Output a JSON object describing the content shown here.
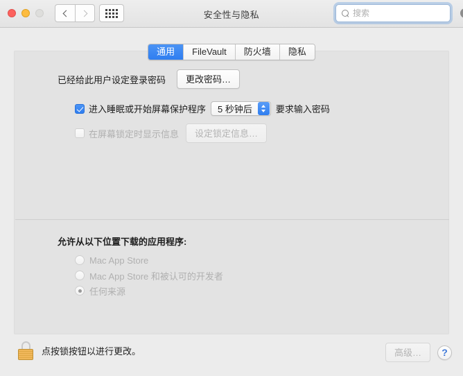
{
  "window": {
    "title": "安全性与隐私",
    "traffic_lights": [
      "close",
      "minimize",
      "zoom"
    ]
  },
  "toolbar": {
    "back_icon": "chevron-left-icon",
    "forward_icon": "chevron-right-icon",
    "show_all_icon": "grid-icon",
    "search": {
      "placeholder": "搜索",
      "value": "",
      "icon": "search-icon",
      "clear_icon": "clear-icon"
    }
  },
  "tabs": [
    {
      "label": "通用",
      "active": true
    },
    {
      "label": "FileVault",
      "active": false
    },
    {
      "label": "防火墙",
      "active": false
    },
    {
      "label": "隐私",
      "active": false
    }
  ],
  "general": {
    "password_status_label": "已经给此用户设定登录密码",
    "change_password_button": "更改密码…",
    "require_password": {
      "checked": true,
      "prefix_label": "进入睡眠或开始屏幕保护程序",
      "delay_value": "5 秒钟后",
      "suffix_label": "要求输入密码"
    },
    "lock_message": {
      "checked": false,
      "label": "在屏幕锁定时显示信息",
      "button": "设定锁定信息…",
      "disabled": true
    },
    "download_section_title": "允许从以下位置下载的应用程序:",
    "download_options": [
      {
        "label": "Mac App Store",
        "selected": false
      },
      {
        "label": "Mac App Store 和被认可的开发者",
        "selected": false
      },
      {
        "label": "任何来源",
        "selected": true
      }
    ]
  },
  "footer": {
    "lock_icon": "lock-icon",
    "lock_text": "点按锁按钮以进行更改。",
    "advanced_button": "高级…",
    "help_button": "?"
  },
  "colors": {
    "accent_blue": "#2f7ef0",
    "window_bg": "#ececec",
    "panel_bg": "#e3e3e3",
    "lock_gold": "#f0b75a",
    "help_blue": "#3f78d8"
  }
}
